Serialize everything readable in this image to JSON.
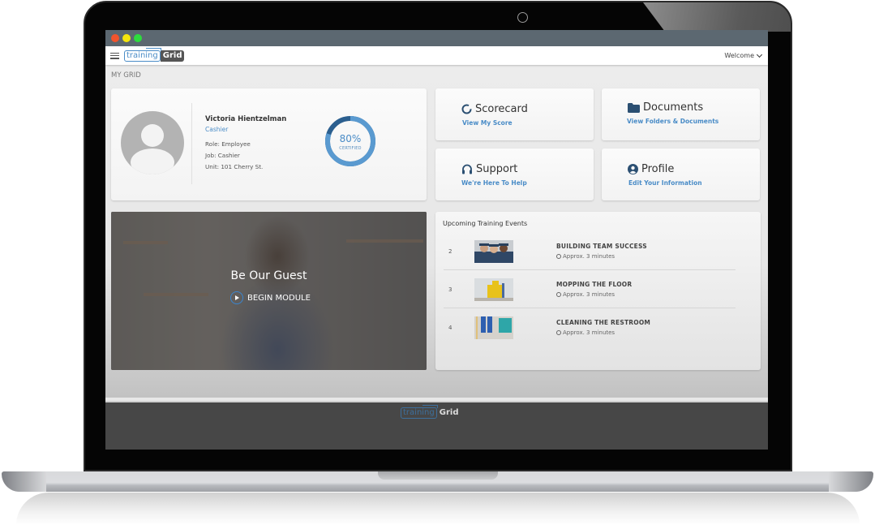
{
  "window": {
    "controls": [
      {
        "name": "close",
        "color": "#f2542d"
      },
      {
        "name": "minimize",
        "color": "#f5e50d"
      },
      {
        "name": "maximize",
        "color": "#2ddc3d"
      }
    ]
  },
  "header": {
    "menu_icon": "hamburger-icon",
    "logo_part1": "training",
    "logo_part2": "Grid",
    "welcome_label": "Welcome",
    "welcome_icon": "chevron-down-icon"
  },
  "page": {
    "section_title": "MY GRID"
  },
  "profile": {
    "name": "Victoria Hientzelman",
    "title": "Cashier",
    "role": "Role: Employee",
    "job": "Job: Cashier",
    "unit": "Unit: 101 Cherry St.",
    "certified_percent": 80,
    "certified_value": "80%",
    "certified_label": "CERTIFIED",
    "colors": {
      "progress": "#5a9ad0",
      "remaining": "#2b5f8f"
    }
  },
  "tiles": [
    {
      "id": "scorecard",
      "title": "Scorecard",
      "link": "View My Score",
      "icon": "circle-notch-icon"
    },
    {
      "id": "documents",
      "title": "Documents",
      "link": "View Folders & Documents",
      "icon": "folder-icon"
    },
    {
      "id": "support",
      "title": "Support",
      "link": "We're Here To Help",
      "icon": "headset-icon"
    },
    {
      "id": "profile",
      "title": "Profile",
      "link": "Edit Your Information",
      "icon": "user-circle-icon"
    }
  ],
  "hero": {
    "title": "Be Our Guest",
    "button_label": "BEGIN MODULE"
  },
  "events": {
    "title": "Upcoming Training Events",
    "items": [
      {
        "num": "2",
        "title": "BUILDING TEAM SUCCESS",
        "duration": "Approx. 3 minutes"
      },
      {
        "num": "3",
        "title": "MOPPING THE FLOOR",
        "duration": "Approx. 3 minutes"
      },
      {
        "num": "4",
        "title": "CLEANING THE RESTROOM",
        "duration": "Approx. 3 minutes"
      }
    ]
  },
  "footer": {
    "logo_part1": "training",
    "logo_part2": "Grid"
  },
  "colors": {
    "accent": "#4a8cc7",
    "titlebar": "#5c6871",
    "footer": "#474747",
    "icon_dark": "#2b4f72"
  }
}
